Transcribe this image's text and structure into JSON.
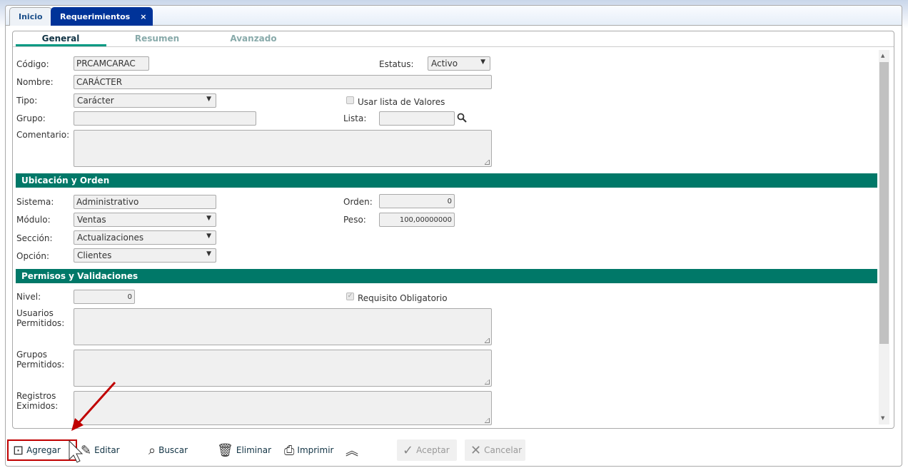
{
  "tabs": [
    {
      "label": "Inicio"
    },
    {
      "label": "Requerimientos",
      "close": "×"
    }
  ],
  "subtabs": [
    "General",
    "Resumen",
    "Avanzado"
  ],
  "general": {
    "codigo_label": "Código:",
    "codigo": "PRCAMCARAC",
    "estatus_label": "Estatus:",
    "estatus": "Activo",
    "nombre_label": "Nombre:",
    "nombre": "CARÁCTER",
    "tipo_label": "Tipo:",
    "tipo": "Carácter",
    "usar_lista_label": "Usar lista de Valores",
    "grupo_label": "Grupo:",
    "grupo": "",
    "lista_label": "Lista:",
    "lista": "",
    "comentario_label": "Comentario:"
  },
  "ubicacion": {
    "title": "Ubicación y Orden",
    "sistema_label": "Sistema:",
    "sistema": "Administrativo",
    "orden_label": "Orden:",
    "orden": "0",
    "modulo_label": "Módulo:",
    "modulo": "Ventas",
    "peso_label": "Peso:",
    "peso": "100,00000000",
    "seccion_label": "Sección:",
    "seccion": "Actualizaciones",
    "opcion_label": "Opción:",
    "opcion": "Clientes"
  },
  "permisos": {
    "title": "Permisos y Validaciones",
    "nivel_label": "Nivel:",
    "nivel": "0",
    "requisito_label": "Requisito Obligatorio",
    "usuarios_label1": "Usuarios",
    "usuarios_label2": "Permitidos:",
    "grupos_label1": "Grupos",
    "grupos_label2": "Permitidos:",
    "registros_label1": "Registros",
    "registros_label2": "Eximidos:"
  },
  "toolbar": {
    "agregar": "Agregar",
    "editar": "Editar",
    "buscar": "Buscar",
    "eliminar": "Eliminar",
    "imprimir": "Imprimir",
    "aceptar": "Aceptar",
    "cancelar": "Cancelar"
  },
  "colors": {
    "accent": "#007868",
    "tab_active": "#003399",
    "highlight": "#c00000"
  }
}
